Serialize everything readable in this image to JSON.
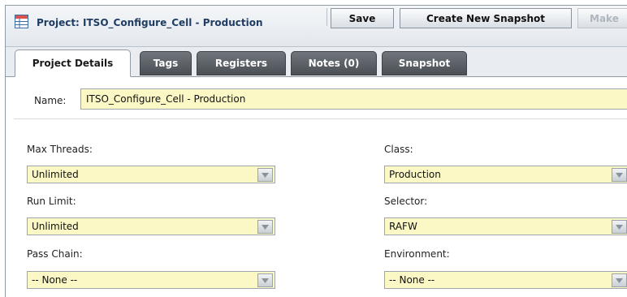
{
  "header": {
    "title": "Project: ITSO_Configure_Cell - Production",
    "icon": "project-table-icon",
    "buttons": {
      "save": "Save",
      "create_snapshot": "Create New Snapshot",
      "make": "Make"
    }
  },
  "tabs": [
    {
      "label": "Project Details",
      "active": true
    },
    {
      "label": "Tags",
      "active": false
    },
    {
      "label": "Registers",
      "active": false
    },
    {
      "label": "Notes (0)",
      "active": false
    },
    {
      "label": "Snapshot",
      "active": false
    }
  ],
  "form": {
    "name_label": "Name:",
    "name_value": "ITSO_Configure_Cell - Production",
    "fields": {
      "max_threads": {
        "label": "Max Threads:",
        "value": "Unlimited"
      },
      "run_limit": {
        "label": "Run Limit:",
        "value": "Unlimited"
      },
      "pass_chain": {
        "label": "Pass Chain:",
        "value": "-- None --"
      },
      "class": {
        "label": "Class:",
        "value": "Production"
      },
      "selector": {
        "label": "Selector:",
        "value": "RAFW"
      },
      "environment": {
        "label": "Environment:",
        "value": "-- None --"
      }
    }
  },
  "colors": {
    "field_bg": "#fbf8c6",
    "tab_inactive": "#5a5f65",
    "title_text": "#1f3c63"
  }
}
